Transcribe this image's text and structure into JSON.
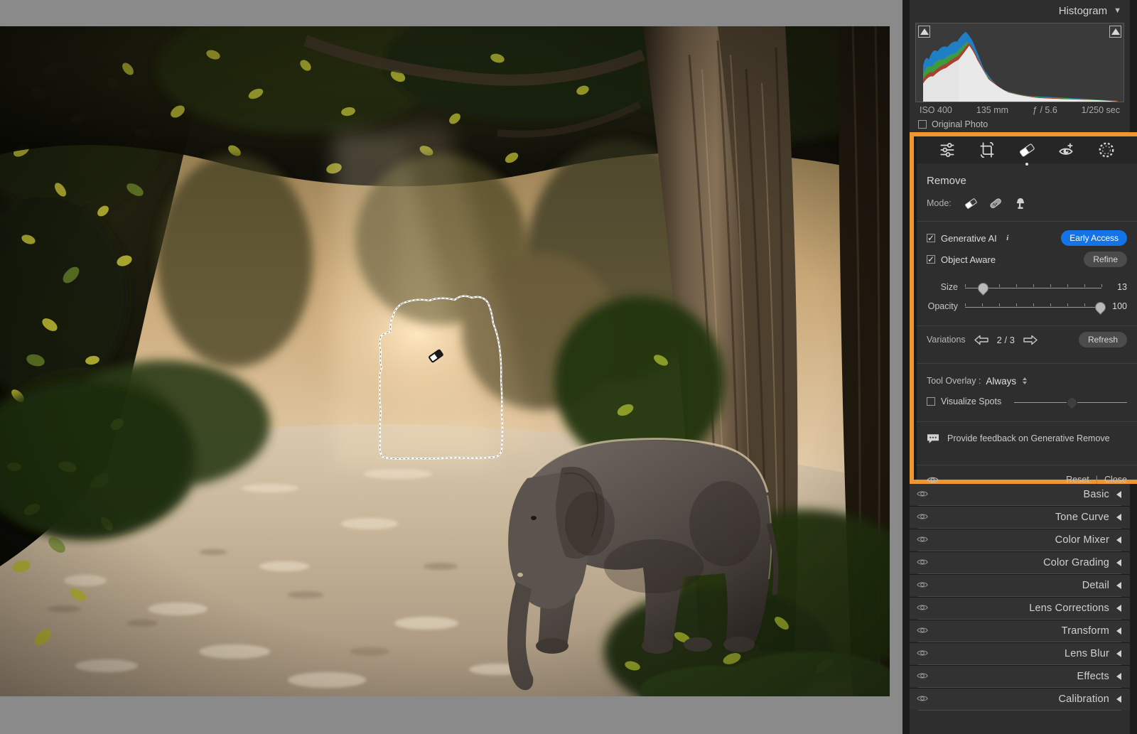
{
  "colors": {
    "accent": "#f0962e",
    "blue": "#1473e6",
    "panel_bg": "#2e2e2e"
  },
  "histogram": {
    "title": "Histogram",
    "collapse_glyph": "▼",
    "exif": {
      "iso": "ISO 400",
      "focal": "135 mm",
      "aperture": "ƒ / 5.6",
      "shutter": "1/250 sec"
    },
    "original_photo_label": "Original Photo",
    "original_photo_checked": false
  },
  "toolstrip": {
    "tools": [
      {
        "name": "edit-sliders-icon",
        "label": "Edit"
      },
      {
        "name": "crop-icon",
        "label": "Crop & Rotate"
      },
      {
        "name": "remove-eraser-icon",
        "label": "Remove",
        "active": true
      },
      {
        "name": "red-eye-icon",
        "label": "Red Eye"
      },
      {
        "name": "masking-icon",
        "label": "Masking"
      }
    ]
  },
  "remove": {
    "title": "Remove",
    "mode_label": "Mode:",
    "modes": [
      {
        "name": "erase-mode-icon",
        "label": "Generative Remove",
        "active": true
      },
      {
        "name": "heal-mode-icon",
        "label": "Heal",
        "active": false
      },
      {
        "name": "clone-mode-icon",
        "label": "Clone",
        "active": false
      }
    ],
    "generative_ai": {
      "label": "Generative AI",
      "checked": true,
      "info_glyph": "i",
      "badge": "Early Access"
    },
    "object_aware": {
      "label": "Object Aware",
      "checked": true,
      "button": "Refine"
    },
    "sliders": [
      {
        "label": "Size",
        "value": "13",
        "percent": 13
      },
      {
        "label": "Opacity",
        "value": "100",
        "percent": 100
      }
    ],
    "variations": {
      "label": "Variations",
      "count": "2 / 3",
      "refresh": "Refresh"
    },
    "tool_overlay": {
      "label": "Tool Overlay :",
      "value": "Always"
    },
    "visualize_spots": {
      "label": "Visualize Spots",
      "checked": false,
      "percent": 50
    },
    "feedback": "Provide feedback on Generative Remove",
    "footer": {
      "reset": "Reset",
      "separator": "|",
      "close": "Close"
    }
  },
  "sections": [
    {
      "label": "Basic"
    },
    {
      "label": "Tone Curve"
    },
    {
      "label": "Color Mixer"
    },
    {
      "label": "Color Grading"
    },
    {
      "label": "Detail"
    },
    {
      "label": "Lens Corrections"
    },
    {
      "label": "Transform"
    },
    {
      "label": "Lens Blur"
    },
    {
      "label": "Effects"
    },
    {
      "label": "Calibration"
    }
  ],
  "photo": {
    "description": "Elephant on a forest dirt track with sunbeams through trees",
    "selection_active": true
  }
}
